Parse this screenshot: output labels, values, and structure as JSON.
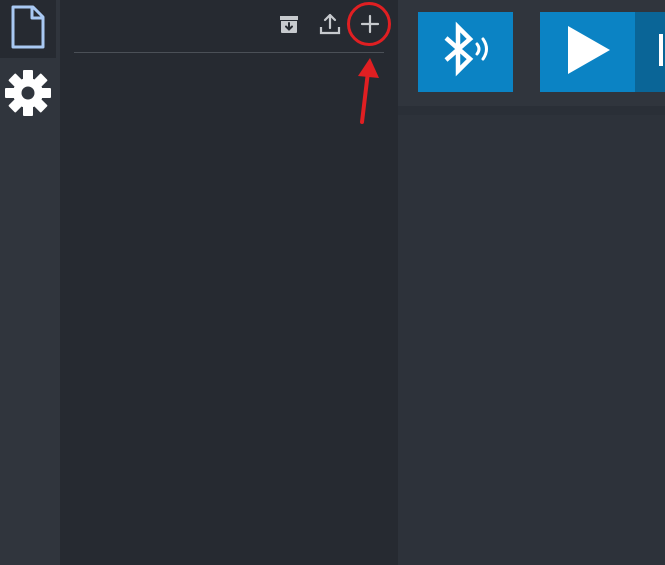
{
  "activity_bar": {
    "items": [
      {
        "name": "files",
        "icon": "file-icon",
        "active": true
      },
      {
        "name": "settings",
        "icon": "gear-icon",
        "active": false
      }
    ]
  },
  "explorer": {
    "toolbar": [
      {
        "name": "archive",
        "icon": "archive-download-icon"
      },
      {
        "name": "export",
        "icon": "upload-icon"
      },
      {
        "name": "new-file",
        "icon": "plus-icon"
      }
    ]
  },
  "workspace": {
    "buttons": [
      {
        "name": "bluetooth",
        "icon": "bluetooth-icon"
      },
      {
        "name": "run",
        "icon": "play-icon"
      },
      {
        "name": "stop",
        "icon": "stop-icon"
      }
    ]
  },
  "colors": {
    "accent": "#0b83c4",
    "accent_dark": "#0a6597",
    "annotation": "#e01f22",
    "icon_active": "#a9c9f3",
    "icon_default": "#ffffff",
    "toolbar_icon": "#c7cace"
  }
}
